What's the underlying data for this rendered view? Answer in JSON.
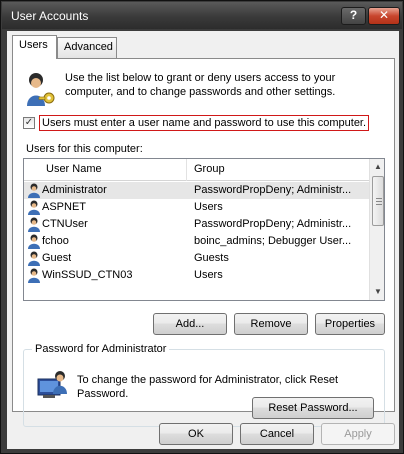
{
  "window": {
    "title": "User Accounts"
  },
  "titlebar": {
    "help_label": "?",
    "close_label": "✕"
  },
  "tabs": [
    {
      "label": "Users"
    },
    {
      "label": "Advanced"
    }
  ],
  "intro": {
    "text": "Use the list below to grant or deny users access to your computer, and to change passwords and other settings."
  },
  "require_login": {
    "checked": true,
    "mark": "✓",
    "label": "Users must enter a user name and password to use this computer."
  },
  "users_section": {
    "label": "Users for this computer:"
  },
  "table": {
    "columns": [
      "User Name",
      "Group"
    ],
    "rows": [
      {
        "name": "Administrator",
        "group": "PasswordPropDeny; Administr..."
      },
      {
        "name": "ASPNET",
        "group": "Users"
      },
      {
        "name": "CTNUser",
        "group": "PasswordPropDeny; Administr..."
      },
      {
        "name": "fchoo",
        "group": "boinc_admins; Debugger User..."
      },
      {
        "name": "Guest",
        "group": "Guests"
      },
      {
        "name": "WinSSUD_CTN03",
        "group": "Users"
      }
    ],
    "selected_row": 0
  },
  "actions": {
    "add": "Add...",
    "remove": "Remove",
    "properties": "Properties"
  },
  "password_group": {
    "title": "Password for Administrator",
    "text": "To change the password for Administrator, click Reset Password.",
    "reset_button": "Reset Password..."
  },
  "footer": {
    "ok": "OK",
    "cancel": "Cancel",
    "apply": "Apply"
  },
  "colors": {
    "highlight_border": "#d01818",
    "selected_row": "#e6e6e6",
    "frame": "#3c3c3c"
  },
  "icons": {
    "intro": "users-key-icon",
    "user": "user-icon",
    "password": "computer-user-icon"
  }
}
